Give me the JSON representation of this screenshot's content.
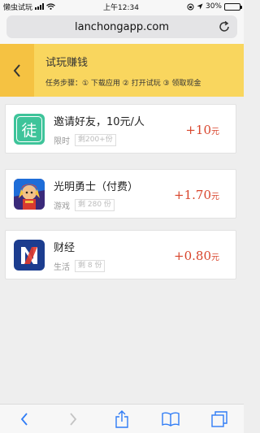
{
  "status_bar": {
    "carrier": "懒虫试玩",
    "time": "上午12:34",
    "battery": "30%",
    "battery_level": 0.3
  },
  "browser": {
    "url": "lanchongapp.com",
    "reload_icon": "reload-icon",
    "toolbar_icons": [
      "back-icon",
      "forward-icon",
      "share-icon",
      "bookmarks-icon",
      "tabs-icon"
    ]
  },
  "header": {
    "title": "试玩赚钱",
    "steps": "任务步骤：① 下载应用 ② 打开试玩 ③ 领取现金",
    "back_icon": "chevron-left-icon"
  },
  "tasks": [
    {
      "name": "邀请好友，10元/人",
      "category": "限时",
      "remaining": "剩200+份",
      "reward": "+10",
      "unit": "元",
      "icon": "apprentice-icon",
      "icon_text": "徒",
      "icon_color": "#3ec49a"
    },
    {
      "name": "光明勇士（付费）",
      "category": "游戏",
      "remaining": "剩 280 份",
      "reward": "+1.70",
      "unit": "元",
      "icon": "game-hero-icon"
    },
    {
      "name": "财经",
      "category": "生活",
      "remaining": "剩 8 份",
      "reward": "+0.80",
      "unit": "元",
      "icon": "finance-app-icon"
    }
  ],
  "colors": {
    "header_bg": "#f9d65e",
    "back_bg": "#f5c242",
    "reward": "#d8442b",
    "toolbar_icon": "#2f7cf6"
  }
}
